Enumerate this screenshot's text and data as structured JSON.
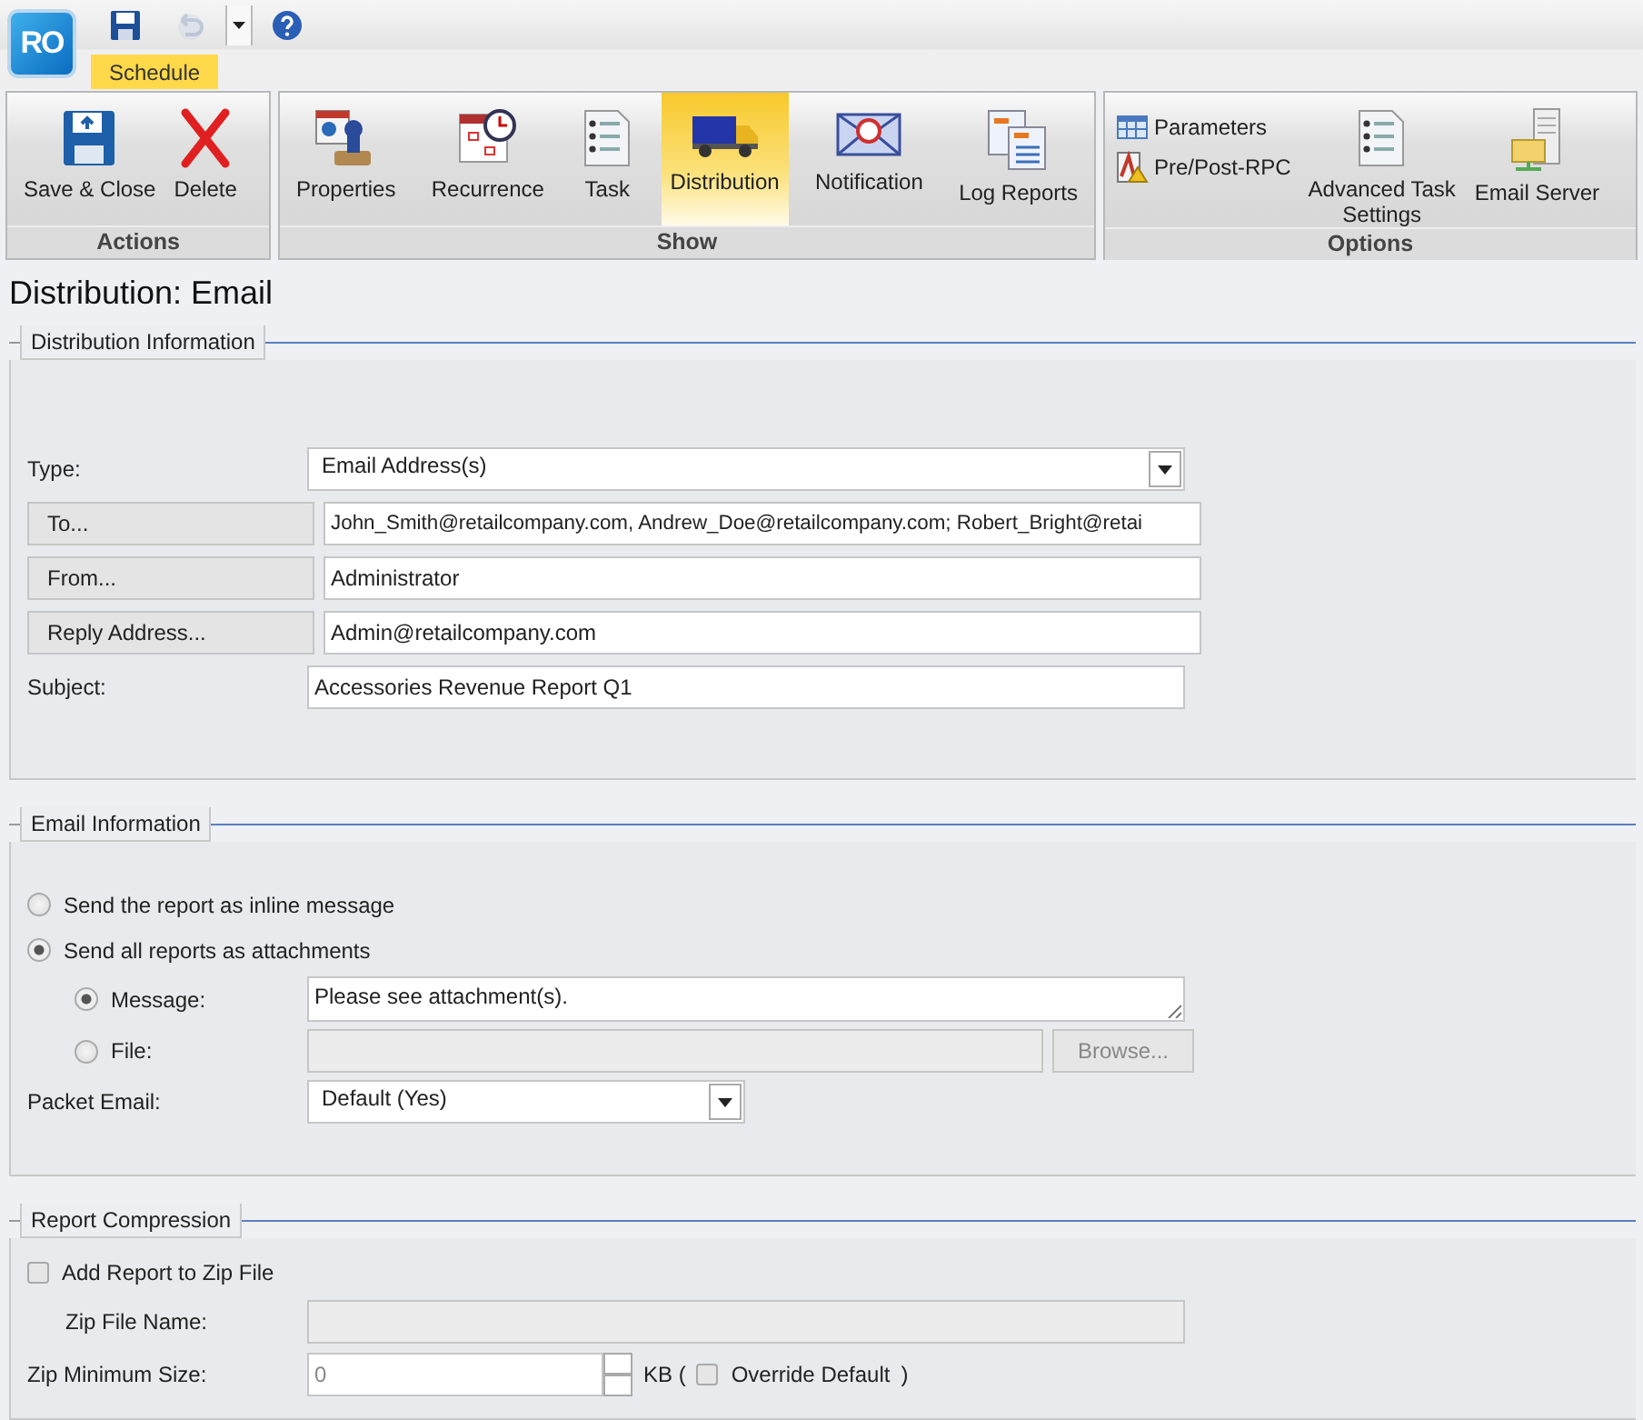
{
  "app": {
    "logo": "RO"
  },
  "quick_access": [
    {
      "kind": "save",
      "disabled": false
    },
    {
      "kind": "undo",
      "disabled": true
    },
    {
      "kind": "dropdown"
    },
    {
      "kind": "help"
    }
  ],
  "tabs": [
    {
      "label": "Schedule",
      "selected": true
    }
  ],
  "ribbon": [
    {
      "label": "Actions",
      "items": [
        {
          "label": "Save & Close",
          "kind": "save",
          "selected": false
        },
        {
          "label": "Delete",
          "kind": "delete",
          "selected": false
        }
      ]
    },
    {
      "label": "Show",
      "items": [
        {
          "label": "Properties",
          "kind": "properties",
          "selected": false
        },
        {
          "label": "Recurrence",
          "kind": "recurrence",
          "selected": false
        },
        {
          "label": "Task",
          "kind": "task",
          "selected": false
        },
        {
          "label": "Distribution",
          "kind": "distribution",
          "selected": true
        },
        {
          "label": "Notification",
          "kind": "notification",
          "selected": false
        },
        {
          "label": "Log Reports",
          "kind": "logs",
          "selected": false
        }
      ]
    },
    {
      "label": "Options",
      "items": [
        {
          "label": "Parameters",
          "kind": "parameters",
          "selected": false
        },
        {
          "label": "Pre/Post-RPC",
          "kind": "prepost",
          "selected": false
        },
        {
          "label": "Advanced Task Settings",
          "kind": "task",
          "selected": false
        },
        {
          "label": "Email Server",
          "kind": "server",
          "selected": false
        }
      ]
    }
  ],
  "page_title": "Distribution: Email",
  "distribution_information": {
    "title": "Distribution Information",
    "fields": [
      {
        "kind": "select",
        "label": "Type:",
        "value": "Email Address(s)"
      },
      {
        "kind": "button",
        "label": "To...",
        "value": "John_Smith@retailcompany.com, Andrew_Doe@retailcompany.com; Robert_Bright@retai"
      },
      {
        "kind": "button",
        "label": "From...",
        "value": "Administrator"
      },
      {
        "kind": "button",
        "label": "Reply Address...",
        "value": "Admin@retailcompany.com"
      },
      {
        "kind": "text",
        "label": "Subject:",
        "value": "Accessories Revenue Report Q1"
      }
    ]
  },
  "email_information": {
    "title": "Email Information",
    "modes": [
      {
        "label": "Send the report as inline message",
        "selected": false
      },
      {
        "label": "Send all reports as attachments",
        "selected": true
      }
    ],
    "content": [
      {
        "kind": "textarea",
        "label": "Message:",
        "selected": true,
        "value": "Please see attachment(s).",
        "disabled": false
      },
      {
        "kind": "file",
        "label": "File:",
        "selected": false,
        "button": "Browse...",
        "disabled": true
      }
    ],
    "packet_email": {
      "label": "Packet Email:",
      "value": "Default (Yes)"
    }
  },
  "report_compression": {
    "title": "Report Compression",
    "add_to_zip": {
      "label": "Add Report to Zip File",
      "checked": false
    },
    "zip_file_name": {
      "label": "Zip File Name:",
      "disabled": true
    },
    "zip_minimum_size": {
      "label": "Zip Minimum Size:",
      "placeholder": "0",
      "unit": "KB (",
      "override": {
        "label": "Override Default",
        "checked": false
      },
      "close": ")"
    }
  }
}
